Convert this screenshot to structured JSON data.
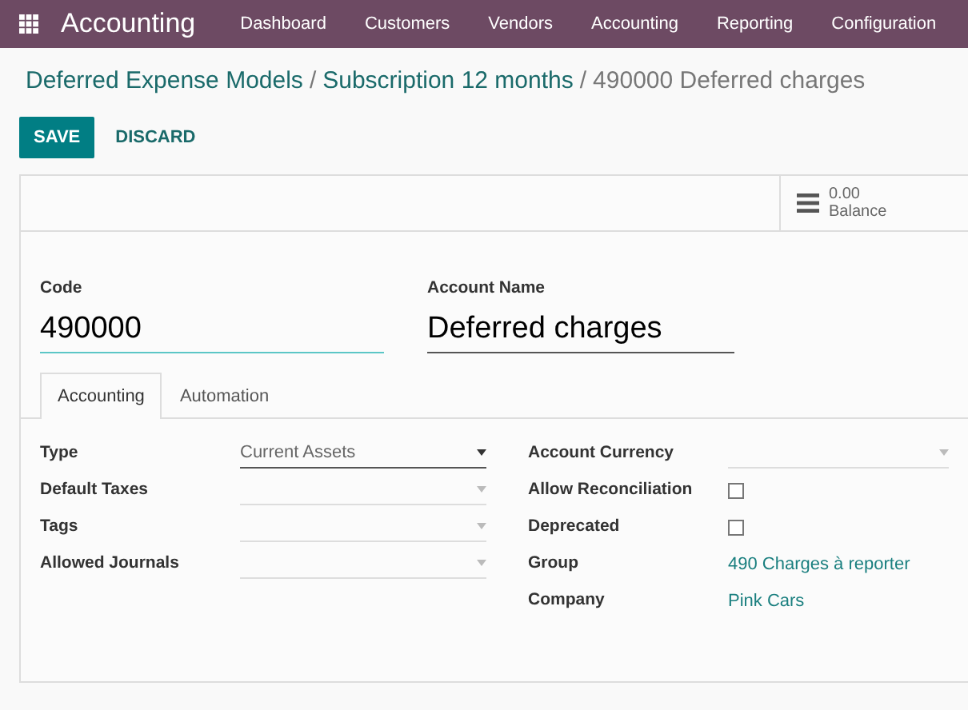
{
  "navbar": {
    "app_name": "Accounting",
    "menu": [
      "Dashboard",
      "Customers",
      "Vendors",
      "Accounting",
      "Reporting",
      "Configuration"
    ]
  },
  "breadcrumb": {
    "links": [
      {
        "label": "Deferred Expense Models",
        "separator": "/"
      },
      {
        "label": "Subscription 12 months",
        "separator": "/"
      }
    ],
    "current": "490000 Deferred charges"
  },
  "buttons": {
    "save": "SAVE",
    "discard": "DISCARD"
  },
  "stat_button": {
    "value": "0.00",
    "label": "Balance"
  },
  "title_fields": [
    {
      "label": "Code",
      "value": "490000",
      "focused": true
    },
    {
      "label": "Account Name",
      "value": "Deferred charges",
      "focused": false
    }
  ],
  "tabs": [
    {
      "label": "Accounting",
      "selected": true
    },
    {
      "label": "Automation",
      "selected": false
    }
  ],
  "left_fields": [
    {
      "label": "Type",
      "kind": "select",
      "value": "Current Assets"
    },
    {
      "label": "Default Taxes",
      "kind": "select"
    },
    {
      "label": "Tags",
      "kind": "select"
    },
    {
      "label": "Allowed Journals",
      "kind": "select"
    }
  ],
  "right_fields": [
    {
      "label": "Account Currency",
      "kind": "select"
    },
    {
      "label": "Allow Reconciliation",
      "kind": "checkbox",
      "checked": false
    },
    {
      "label": "Deprecated",
      "kind": "checkbox",
      "checked": false
    },
    {
      "label": "Group",
      "kind": "link",
      "value": "490 Charges à reporter"
    },
    {
      "label": "Company",
      "kind": "link",
      "value": "Pink Cars"
    }
  ]
}
